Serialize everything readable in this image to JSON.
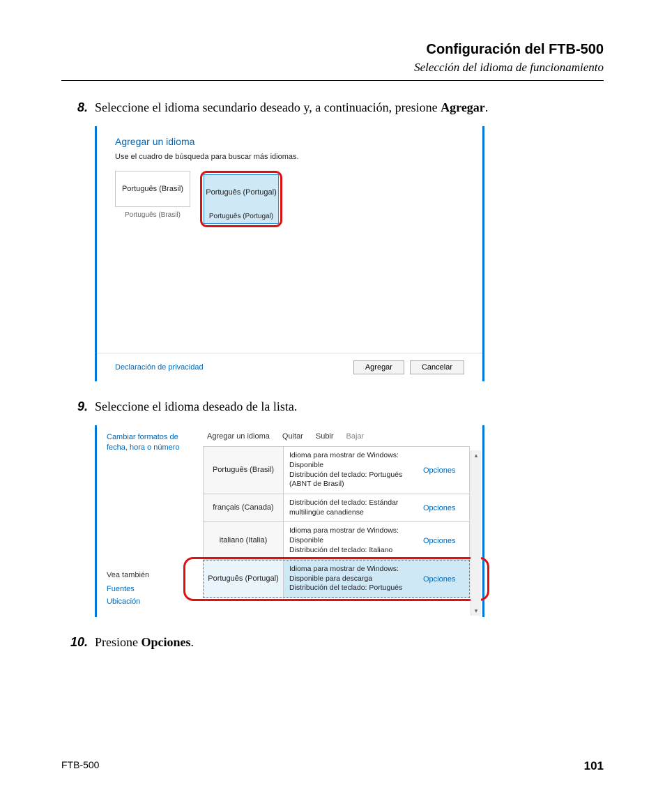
{
  "header": {
    "title": "Configuración del FTB-500",
    "subtitle": "Selección del idioma de funcionamiento"
  },
  "steps": {
    "s8": {
      "num": "8.",
      "text_a": "Seleccione el idioma secundario deseado y, a continuación, presione ",
      "bold": "Agregar",
      "text_b": "."
    },
    "s9": {
      "num": "9.",
      "text": "Seleccione el idioma deseado de la lista."
    },
    "s10": {
      "num": "10.",
      "text_a": "Presione ",
      "bold": "Opciones",
      "text_b": "."
    }
  },
  "screenshot1": {
    "title": "Agregar un idioma",
    "hint": "Use el cuadro de búsqueda para buscar más idiomas.",
    "tile_unselected": {
      "name": "Português (Brasil)",
      "label": "Português (Brasil)"
    },
    "tile_selected": {
      "name": "Português (Portugal)",
      "label": "Português (Portugal)"
    },
    "privacy": "Declaración de privacidad",
    "btn_add": "Agregar",
    "btn_cancel": "Cancelar"
  },
  "screenshot2": {
    "left_title": "Cambiar formatos de fecha, hora o número",
    "see_also": "Vea también",
    "link_fonts": "Fuentes",
    "link_location": "Ubicación",
    "toolbar": {
      "add": "Agregar un idioma",
      "remove": "Quitar",
      "up": "Subir",
      "down": "Bajar"
    },
    "rows": [
      {
        "name": "Português (Brasil)",
        "desc": "Idioma para mostrar de Windows: Disponible\nDistribución del teclado: Portugués (ABNT de Brasil)",
        "opt": "Opciones"
      },
      {
        "name": "français (Canada)",
        "desc": "Distribución del teclado: Estándar multilingüe canadiense",
        "opt": "Opciones"
      },
      {
        "name": "italiano (Italia)",
        "desc": "Idioma para mostrar de Windows: Disponible\nDistribución del teclado: Italiano",
        "opt": "Opciones"
      },
      {
        "name": "Português (Portugal)",
        "desc": "Idioma para mostrar de Windows: Disponible para descarga\nDistribución del teclado: Portugués",
        "opt": "Opciones"
      }
    ]
  },
  "footer": {
    "product": "FTB-500",
    "page": "101"
  }
}
